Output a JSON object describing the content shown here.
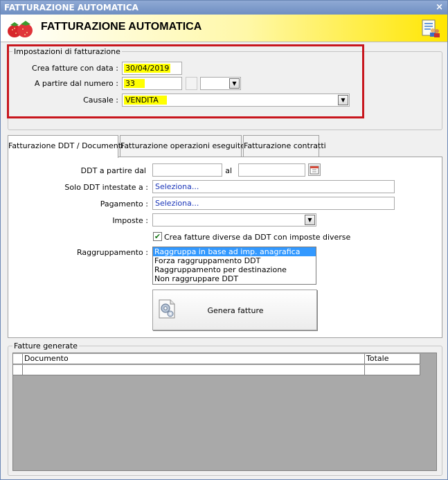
{
  "window": {
    "title": "FATTURAZIONE AUTOMATICA",
    "close_symbol": "×"
  },
  "header": {
    "title": "FATTURAZIONE AUTOMATICA"
  },
  "settings": {
    "legend": "Impostazioni di fatturazione",
    "date_label": "Crea fatture con data :",
    "date_value": "30/04/2019",
    "number_label": "A partire dal numero :",
    "number_value": "33",
    "suffix_value": "",
    "causale_label": "Causale :",
    "causale_value": "VENDITA"
  },
  "tabs": [
    {
      "label": "Fatturazione DDT / Documenti",
      "active": true
    },
    {
      "label": "Fatturazione operazioni eseguite",
      "active": false
    },
    {
      "label": "Fatturazione contratti",
      "active": false
    }
  ],
  "ddt": {
    "from_label": "DDT a partire dal",
    "from_value": "",
    "to_label": "al",
    "to_value": "",
    "owner_label": "Solo DDT intestate a :",
    "owner_value": "Seleziona...",
    "payment_label": "Pagamento :",
    "payment_value": "Seleziona...",
    "tax_label": "Imposte :",
    "tax_value": "",
    "diverse_checkbox_label": "Crea fatture diverse da DDT con imposte diverse",
    "diverse_checked": true,
    "grouping_label": "Raggruppamento :",
    "grouping_options": [
      "Raggruppa in base ad imp. anagrafica",
      "Forza raggruppamento DDT",
      "Raggruppamento per destinazione",
      "Non raggruppare DDT"
    ],
    "grouping_selected": 0,
    "generate_label": "Genera fatture"
  },
  "results": {
    "legend": "Fatture generate",
    "columns": [
      "Documento",
      "Totale"
    ]
  },
  "colors": {
    "highlight": "#ffff00",
    "callout_border": "#c8161d",
    "selection": "#3399ff",
    "link_text": "#1a35b8"
  }
}
